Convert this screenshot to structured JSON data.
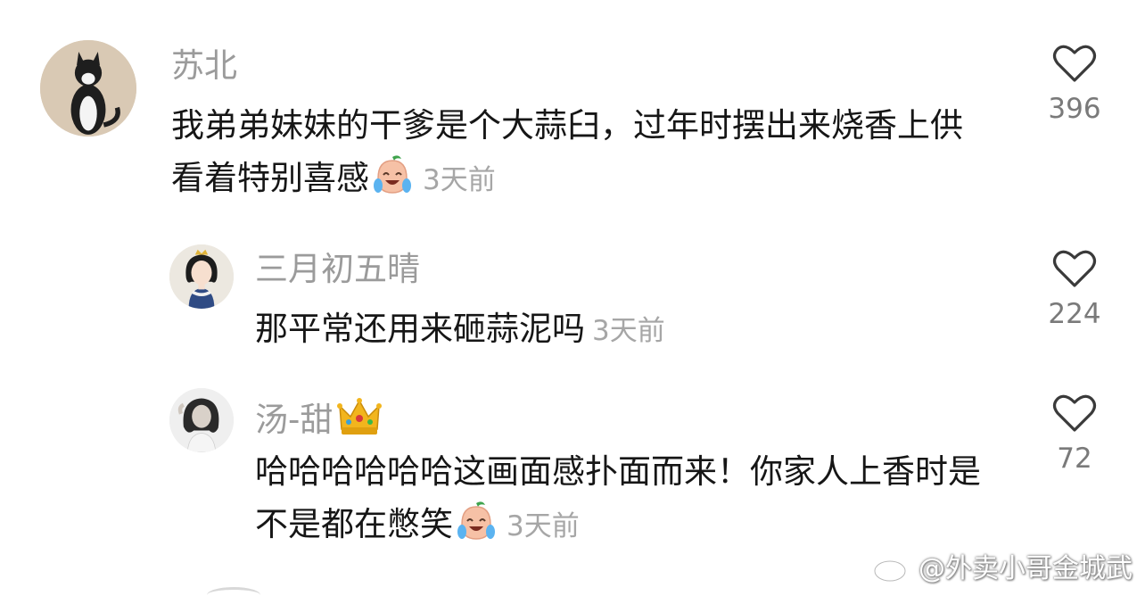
{
  "comments": [
    {
      "username": "苏北",
      "text": "我弟弟妹妹的干爹是个大蒜臼，过年时摆出来烧香上供看着特别喜感",
      "time": "3天前",
      "likes": "396"
    },
    {
      "username": "三月初五晴",
      "text": "那平常还用来砸蒜泥吗",
      "time": "3天前",
      "likes": "224"
    },
    {
      "username": "汤-甜",
      "text": "哈哈哈哈哈哈这画面感扑面而来！你家人上香时是不是都在憋笑",
      "time": "3天前",
      "likes": "72"
    }
  ],
  "watermark": "@外卖小哥金城武",
  "icons": {
    "like": "heart-outline-icon",
    "emoji": "laugh-cry-emoji",
    "badge": "crown-icon",
    "logo": "weibo-logo"
  },
  "colors": {
    "username": "#9b9b9b",
    "text": "#161616",
    "meta": "#a6a6a6"
  }
}
